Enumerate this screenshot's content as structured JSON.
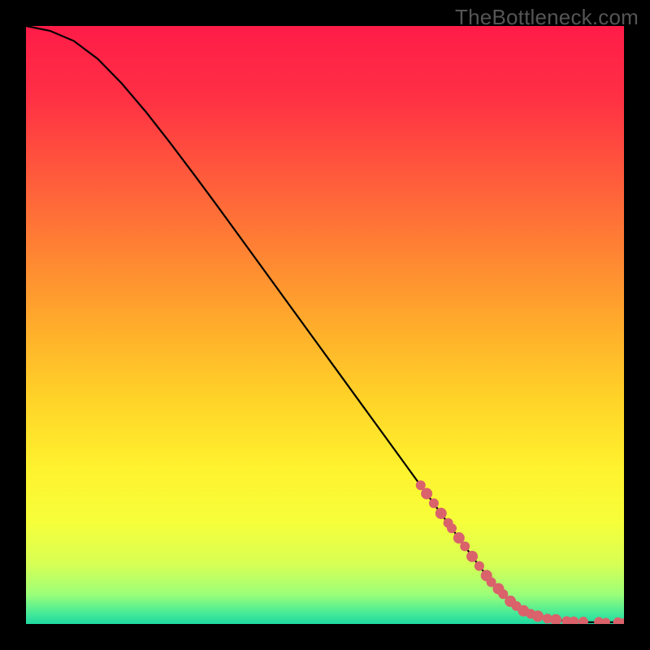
{
  "watermark": "TheBottleneck.com",
  "chart_data": {
    "type": "line",
    "title": "",
    "xlabel": "",
    "ylabel": "",
    "xlim": [
      0,
      100
    ],
    "ylim": [
      0,
      100
    ],
    "grid": false,
    "legend": false,
    "series": [
      {
        "name": "curve",
        "stroke": "#000000",
        "x": [
          0,
          4,
          8,
          12,
          16,
          20,
          24,
          28,
          32,
          36,
          40,
          44,
          48,
          52,
          56,
          60,
          64,
          68,
          72,
          76,
          80,
          84,
          88,
          92,
          94,
          96,
          98,
          100
        ],
        "y": [
          100,
          99.2,
          97.5,
          94.5,
          90.4,
          85.7,
          80.6,
          75.3,
          69.9,
          64.4,
          58.9,
          53.4,
          47.9,
          42.4,
          36.9,
          31.4,
          25.9,
          20.4,
          14.9,
          9.4,
          4.8,
          1.9,
          0.7,
          0.35,
          0.3,
          0.3,
          0.3,
          0.3
        ]
      }
    ],
    "scatter_overlay": {
      "name": "highlight-points",
      "color": "#D9626B",
      "points": [
        {
          "x": 66,
          "y": 23.2,
          "r": 6
        },
        {
          "x": 67,
          "y": 21.8,
          "r": 7
        },
        {
          "x": 68.2,
          "y": 20.2,
          "r": 6
        },
        {
          "x": 69.4,
          "y": 18.5,
          "r": 7
        },
        {
          "x": 70.6,
          "y": 16.9,
          "r": 6
        },
        {
          "x": 71.2,
          "y": 16.0,
          "r": 6
        },
        {
          "x": 72.4,
          "y": 14.4,
          "r": 7
        },
        {
          "x": 73.4,
          "y": 13.0,
          "r": 6
        },
        {
          "x": 74.6,
          "y": 11.3,
          "r": 7
        },
        {
          "x": 75.8,
          "y": 9.7,
          "r": 6
        },
        {
          "x": 77.0,
          "y": 8.1,
          "r": 7
        },
        {
          "x": 77.8,
          "y": 7.0,
          "r": 6
        },
        {
          "x": 79.0,
          "y": 5.9,
          "r": 7
        },
        {
          "x": 79.8,
          "y": 5.0,
          "r": 6
        },
        {
          "x": 81.0,
          "y": 3.8,
          "r": 7
        },
        {
          "x": 82.0,
          "y": 3.0,
          "r": 6
        },
        {
          "x": 83.2,
          "y": 2.2,
          "r": 7
        },
        {
          "x": 84.4,
          "y": 1.7,
          "r": 6
        },
        {
          "x": 85.6,
          "y": 1.3,
          "r": 7
        },
        {
          "x": 87.2,
          "y": 0.9,
          "r": 6
        },
        {
          "x": 88.6,
          "y": 0.7,
          "r": 7
        },
        {
          "x": 90.4,
          "y": 0.5,
          "r": 6
        },
        {
          "x": 91.6,
          "y": 0.45,
          "r": 6
        },
        {
          "x": 93.2,
          "y": 0.4,
          "r": 6
        },
        {
          "x": 95.8,
          "y": 0.35,
          "r": 6
        },
        {
          "x": 97.0,
          "y": 0.35,
          "r": 5
        },
        {
          "x": 99.0,
          "y": 0.3,
          "r": 6
        },
        {
          "x": 100.0,
          "y": 0.3,
          "r": 5
        }
      ]
    },
    "background_gradient": {
      "stops": [
        {
          "offset": 0.0,
          "color": "#FF1C48"
        },
        {
          "offset": 0.12,
          "color": "#FF3044"
        },
        {
          "offset": 0.25,
          "color": "#FF5A3C"
        },
        {
          "offset": 0.38,
          "color": "#FF8433"
        },
        {
          "offset": 0.5,
          "color": "#FFAC2B"
        },
        {
          "offset": 0.62,
          "color": "#FFD228"
        },
        {
          "offset": 0.74,
          "color": "#FFF22E"
        },
        {
          "offset": 0.83,
          "color": "#F6FF3A"
        },
        {
          "offset": 0.9,
          "color": "#D7FF54"
        },
        {
          "offset": 0.95,
          "color": "#9CFF78"
        },
        {
          "offset": 0.985,
          "color": "#3FE89A"
        },
        {
          "offset": 1.0,
          "color": "#1FD8A0"
        }
      ]
    }
  }
}
